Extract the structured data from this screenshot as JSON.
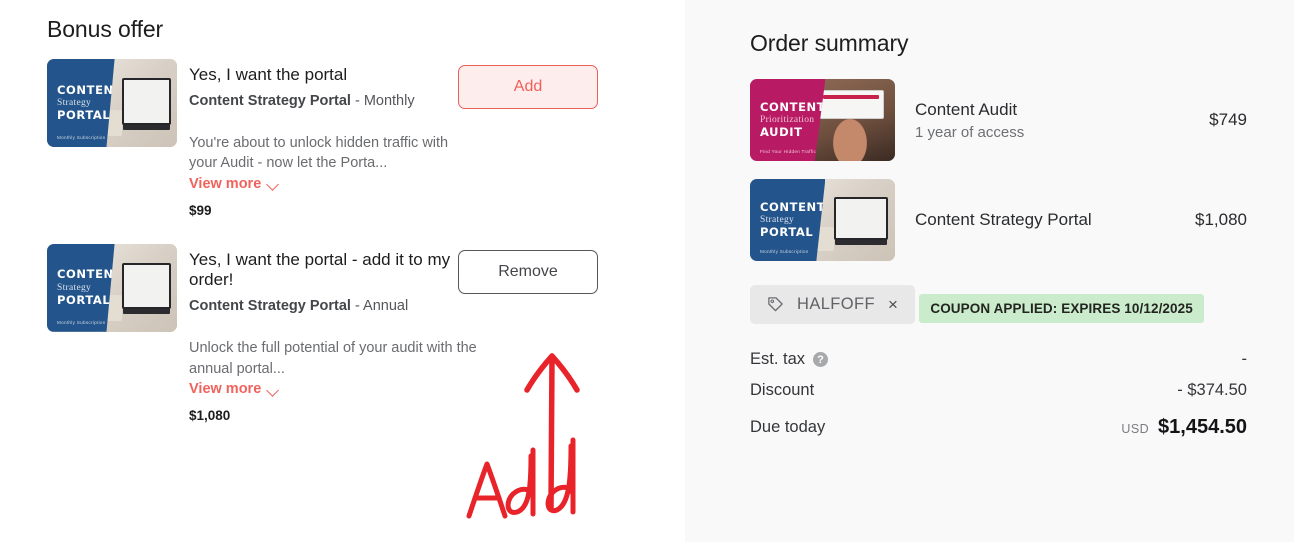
{
  "bonus": {
    "title": "Bonus offer",
    "offers": [
      {
        "heading": "Yes, I want the portal",
        "product": "Content Strategy Portal",
        "term": " - Monthly",
        "description": "You're about to unlock hidden traffic with your Audit - now let the Porta...",
        "view_more": "View more",
        "price": "$99",
        "action": "Add",
        "thumb": {
          "line1": "CONTENT",
          "line2": "Strategy",
          "line3": "PORTAL",
          "line4": "Monthly Subscription"
        }
      },
      {
        "heading": "Yes, I want the portal - add it to my order!",
        "product": "Content Strategy Portal",
        "term": " - Annual",
        "description": "Unlock the full potential of your audit with the annual portal...",
        "view_more": "View more",
        "price": "$1,080",
        "action": "Remove",
        "thumb": {
          "line1": "CONTENT",
          "line2": "Strategy",
          "line3": "PORTAL",
          "line4": "Monthly Subscription"
        }
      }
    ]
  },
  "annotation": {
    "text": "Add",
    "color": "#e8232a"
  },
  "summary": {
    "title": "Order summary",
    "items": [
      {
        "name": "Content Audit",
        "meta": "1 year of access",
        "price": "$749",
        "thumb": {
          "line1": "CONTENT",
          "line2": "Prioritization",
          "line3": "AUDIT",
          "line4": "Find Your Hidden Traffic"
        }
      },
      {
        "name": "Content Strategy Portal",
        "meta": "",
        "price": "$1,080",
        "thumb": {
          "line1": "CONTENT",
          "line2": "Strategy",
          "line3": "PORTAL",
          "line4": "Monthly Subscription"
        }
      }
    ],
    "coupon": {
      "code": "HALFOFF",
      "remove": "×",
      "applied": "COUPON APPLIED: EXPIRES 10/12/2025"
    },
    "totals": [
      {
        "label": "Est. tax",
        "value": "-",
        "has_help": true
      },
      {
        "label": "Discount",
        "value": "- $374.50",
        "has_help": false
      }
    ],
    "due": {
      "label": "Due today",
      "currency": "USD",
      "amount": "$1,454.50"
    }
  },
  "colors": {
    "accent_red": "#f0625c",
    "add_border": "#ef5f5a",
    "add_fill": "#fdeeed",
    "coupon_green": "#caeccd",
    "panel_bg": "#f9f9f9",
    "thumb_blue": "#23558c",
    "thumb_magenta": "#b81a64"
  }
}
